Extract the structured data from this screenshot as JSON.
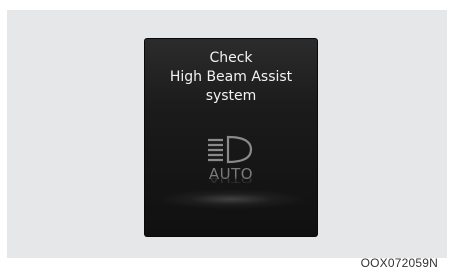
{
  "display": {
    "message": {
      "line1": "Check",
      "line2": "High Beam Assist",
      "line3": "system"
    },
    "icon_name": "high-beam-auto-icon",
    "icon_label": "AUTO"
  },
  "figure": {
    "reference_code": "OOX072059N"
  },
  "colors": {
    "icon": "#8a8a8a",
    "text": "#f2f2f2",
    "screen": "#1b1b1b"
  }
}
